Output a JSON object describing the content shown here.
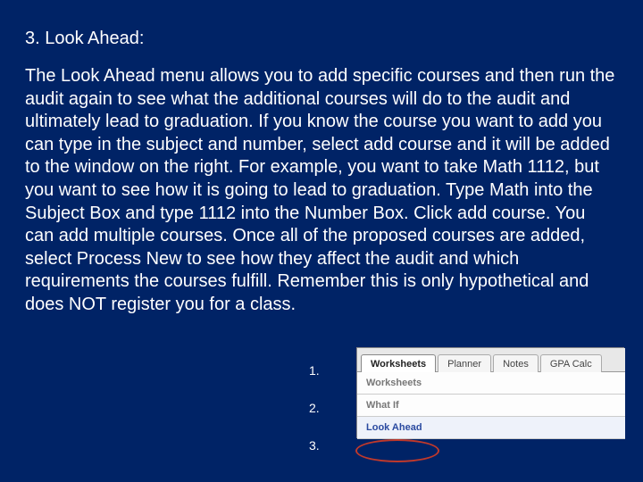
{
  "heading": "3. Look Ahead:",
  "body": "The Look Ahead menu allows you to add specific courses and then run the audit again to see what the additional courses will do to the audit and ultimately lead to graduation. If you know the course you want to add you can type in the subject and number, select add course and it will be added to the window on the right. For example, you want to take Math 1112, but you want to see how it is going to lead to graduation. Type Math into the Subject Box and type 1112 into the Number Box. Click add course. You can add multiple courses. Once all of the proposed courses are added, select Process New to see how they affect the audit and which requirements the courses fulfill. Remember this is only hypothetical and does NOT register you for a class.",
  "list": {
    "n1": "1.",
    "n2": "2.",
    "n3": "3."
  },
  "inset": {
    "tabs": {
      "worksheets": "Worksheets",
      "planner": "Planner",
      "notes": "Notes",
      "gpacalc": "GPA Calc"
    },
    "menu": {
      "worksheets": "Worksheets",
      "whatif": "What If",
      "lookahead": "Look Ahead"
    }
  }
}
